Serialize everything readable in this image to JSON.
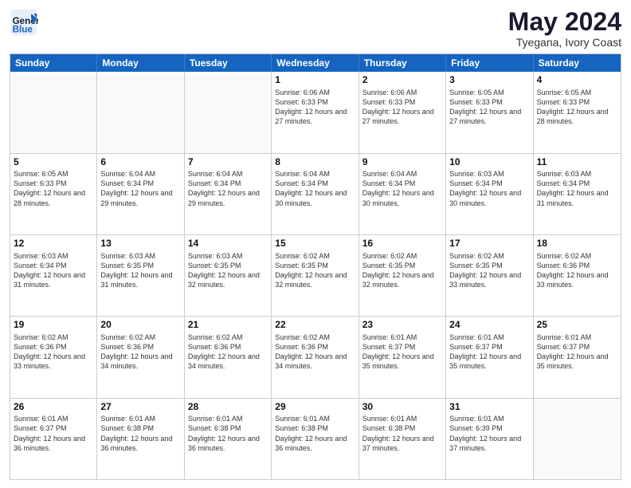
{
  "header": {
    "logo_line1": "General",
    "logo_line2": "Blue",
    "month": "May 2024",
    "location": "Tyegana, Ivory Coast"
  },
  "day_headers": [
    "Sunday",
    "Monday",
    "Tuesday",
    "Wednesday",
    "Thursday",
    "Friday",
    "Saturday"
  ],
  "weeks": [
    {
      "days": [
        {
          "num": "",
          "info": "",
          "empty": true
        },
        {
          "num": "",
          "info": "",
          "empty": true
        },
        {
          "num": "",
          "info": "",
          "empty": true
        },
        {
          "num": "1",
          "info": "Sunrise: 6:06 AM\nSunset: 6:33 PM\nDaylight: 12 hours and 27 minutes."
        },
        {
          "num": "2",
          "info": "Sunrise: 6:06 AM\nSunset: 6:33 PM\nDaylight: 12 hours and 27 minutes."
        },
        {
          "num": "3",
          "info": "Sunrise: 6:05 AM\nSunset: 6:33 PM\nDaylight: 12 hours and 27 minutes."
        },
        {
          "num": "4",
          "info": "Sunrise: 6:05 AM\nSunset: 6:33 PM\nDaylight: 12 hours and 28 minutes."
        }
      ]
    },
    {
      "days": [
        {
          "num": "5",
          "info": "Sunrise: 6:05 AM\nSunset: 6:33 PM\nDaylight: 12 hours and 28 minutes."
        },
        {
          "num": "6",
          "info": "Sunrise: 6:04 AM\nSunset: 6:34 PM\nDaylight: 12 hours and 29 minutes."
        },
        {
          "num": "7",
          "info": "Sunrise: 6:04 AM\nSunset: 6:34 PM\nDaylight: 12 hours and 29 minutes."
        },
        {
          "num": "8",
          "info": "Sunrise: 6:04 AM\nSunset: 6:34 PM\nDaylight: 12 hours and 30 minutes."
        },
        {
          "num": "9",
          "info": "Sunrise: 6:04 AM\nSunset: 6:34 PM\nDaylight: 12 hours and 30 minutes."
        },
        {
          "num": "10",
          "info": "Sunrise: 6:03 AM\nSunset: 6:34 PM\nDaylight: 12 hours and 30 minutes."
        },
        {
          "num": "11",
          "info": "Sunrise: 6:03 AM\nSunset: 6:34 PM\nDaylight: 12 hours and 31 minutes."
        }
      ]
    },
    {
      "days": [
        {
          "num": "12",
          "info": "Sunrise: 6:03 AM\nSunset: 6:34 PM\nDaylight: 12 hours and 31 minutes."
        },
        {
          "num": "13",
          "info": "Sunrise: 6:03 AM\nSunset: 6:35 PM\nDaylight: 12 hours and 31 minutes."
        },
        {
          "num": "14",
          "info": "Sunrise: 6:03 AM\nSunset: 6:35 PM\nDaylight: 12 hours and 32 minutes."
        },
        {
          "num": "15",
          "info": "Sunrise: 6:02 AM\nSunset: 6:35 PM\nDaylight: 12 hours and 32 minutes."
        },
        {
          "num": "16",
          "info": "Sunrise: 6:02 AM\nSunset: 6:35 PM\nDaylight: 12 hours and 32 minutes."
        },
        {
          "num": "17",
          "info": "Sunrise: 6:02 AM\nSunset: 6:35 PM\nDaylight: 12 hours and 33 minutes."
        },
        {
          "num": "18",
          "info": "Sunrise: 6:02 AM\nSunset: 6:36 PM\nDaylight: 12 hours and 33 minutes."
        }
      ]
    },
    {
      "days": [
        {
          "num": "19",
          "info": "Sunrise: 6:02 AM\nSunset: 6:36 PM\nDaylight: 12 hours and 33 minutes."
        },
        {
          "num": "20",
          "info": "Sunrise: 6:02 AM\nSunset: 6:36 PM\nDaylight: 12 hours and 34 minutes."
        },
        {
          "num": "21",
          "info": "Sunrise: 6:02 AM\nSunset: 6:36 PM\nDaylight: 12 hours and 34 minutes."
        },
        {
          "num": "22",
          "info": "Sunrise: 6:02 AM\nSunset: 6:36 PM\nDaylight: 12 hours and 34 minutes."
        },
        {
          "num": "23",
          "info": "Sunrise: 6:01 AM\nSunset: 6:37 PM\nDaylight: 12 hours and 35 minutes."
        },
        {
          "num": "24",
          "info": "Sunrise: 6:01 AM\nSunset: 6:37 PM\nDaylight: 12 hours and 35 minutes."
        },
        {
          "num": "25",
          "info": "Sunrise: 6:01 AM\nSunset: 6:37 PM\nDaylight: 12 hours and 35 minutes."
        }
      ]
    },
    {
      "days": [
        {
          "num": "26",
          "info": "Sunrise: 6:01 AM\nSunset: 6:37 PM\nDaylight: 12 hours and 36 minutes."
        },
        {
          "num": "27",
          "info": "Sunrise: 6:01 AM\nSunset: 6:38 PM\nDaylight: 12 hours and 36 minutes."
        },
        {
          "num": "28",
          "info": "Sunrise: 6:01 AM\nSunset: 6:38 PM\nDaylight: 12 hours and 36 minutes."
        },
        {
          "num": "29",
          "info": "Sunrise: 6:01 AM\nSunset: 6:38 PM\nDaylight: 12 hours and 36 minutes."
        },
        {
          "num": "30",
          "info": "Sunrise: 6:01 AM\nSunset: 6:38 PM\nDaylight: 12 hours and 37 minutes."
        },
        {
          "num": "31",
          "info": "Sunrise: 6:01 AM\nSunset: 6:39 PM\nDaylight: 12 hours and 37 minutes."
        },
        {
          "num": "",
          "info": "",
          "empty": true
        }
      ]
    }
  ]
}
